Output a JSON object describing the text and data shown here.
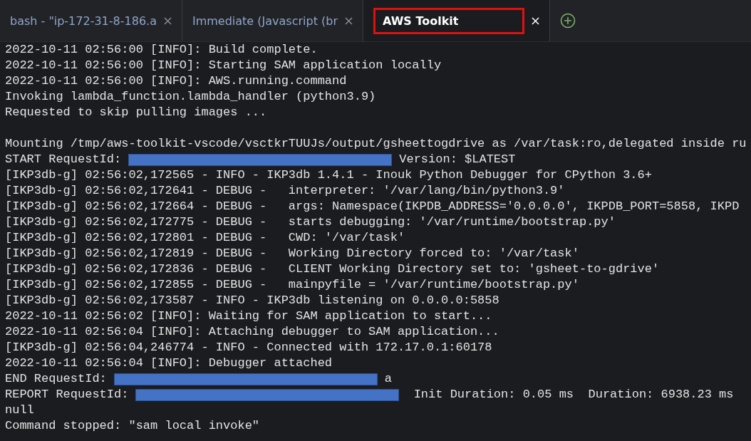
{
  "tabs": [
    {
      "label": "bash - \"ip-172-31-8-186.a",
      "selected": false
    },
    {
      "label": "Immediate (Javascript (br",
      "selected": false
    },
    {
      "label": "AWS Toolkit",
      "selected": true
    }
  ],
  "terminal": {
    "lines": [
      {
        "kind": "text",
        "text": "2022-10-11 02:56:00 [INFO]: Build complete."
      },
      {
        "kind": "text",
        "text": "2022-10-11 02:56:00 [INFO]: Starting SAM application locally"
      },
      {
        "kind": "text",
        "text": "2022-10-11 02:56:00 [INFO]: AWS.running.command"
      },
      {
        "kind": "text",
        "text": "Invoking lambda_function.lambda_handler (python3.9)"
      },
      {
        "kind": "text",
        "text": "Requested to skip pulling images ..."
      },
      {
        "kind": "blank"
      },
      {
        "kind": "text",
        "text": "Mounting /tmp/aws-toolkit-vscode/vsctkrTUUJs/output/gsheettogdrive as /var/task:ro,delegated inside ru"
      },
      {
        "kind": "redacted",
        "prefix": "START RequestId:",
        "suffix": "Version: $LATEST"
      },
      {
        "kind": "text",
        "text": "[IKP3db-g] 02:56:02,172565 - INFO - IKP3db 1.4.1 - Inouk Python Debugger for CPython 3.6+"
      },
      {
        "kind": "text",
        "text": "[IKP3db-g] 02:56:02,172641 - DEBUG -   interpreter: '/var/lang/bin/python3.9'"
      },
      {
        "kind": "text",
        "text": "[IKP3db-g] 02:56:02,172664 - DEBUG -   args: Namespace(IKPDB_ADDRESS='0.0.0.0', IKPDB_PORT=5858, IKPD"
      },
      {
        "kind": "text",
        "text": "[IKP3db-g] 02:56:02,172775 - DEBUG -   starts debugging: '/var/runtime/bootstrap.py'"
      },
      {
        "kind": "text",
        "text": "[IKP3db-g] 02:56:02,172801 - DEBUG -   CWD: '/var/task'"
      },
      {
        "kind": "text",
        "text": "[IKP3db-g] 02:56:02,172819 - DEBUG -   Working Directory forced to: '/var/task'"
      },
      {
        "kind": "text",
        "text": "[IKP3db-g] 02:56:02,172836 - DEBUG -   CLIENT Working Directory set to: 'gsheet-to-gdrive'"
      },
      {
        "kind": "text",
        "text": "[IKP3db-g] 02:56:02,172855 - DEBUG -   mainpyfile = '/var/runtime/bootstrap.py'"
      },
      {
        "kind": "text",
        "text": "[IKP3db-g] 02:56:02,173587 - INFO - IKP3db listening on 0.0.0.0:5858"
      },
      {
        "kind": "text",
        "text": "2022-10-11 02:56:02 [INFO]: Waiting for SAM application to start..."
      },
      {
        "kind": "text",
        "text": "2022-10-11 02:56:04 [INFO]: Attaching debugger to SAM application..."
      },
      {
        "kind": "text",
        "text": "[IKP3db-g] 02:56:04,246774 - INFO - Connected with 172.17.0.1:60178"
      },
      {
        "kind": "text",
        "text": "2022-10-11 02:56:04 [INFO]: Debugger attached"
      },
      {
        "kind": "redacted",
        "prefix": "END RequestId:",
        "suffix": "a"
      },
      {
        "kind": "redacted",
        "prefix": "REPORT RequestId:",
        "suffix": " Init Duration: 0.05 ms  Duration: 6938.23 ms"
      },
      {
        "kind": "text",
        "text": "null"
      },
      {
        "kind": "text",
        "text": "Command stopped: \"sam local invoke\""
      }
    ]
  }
}
